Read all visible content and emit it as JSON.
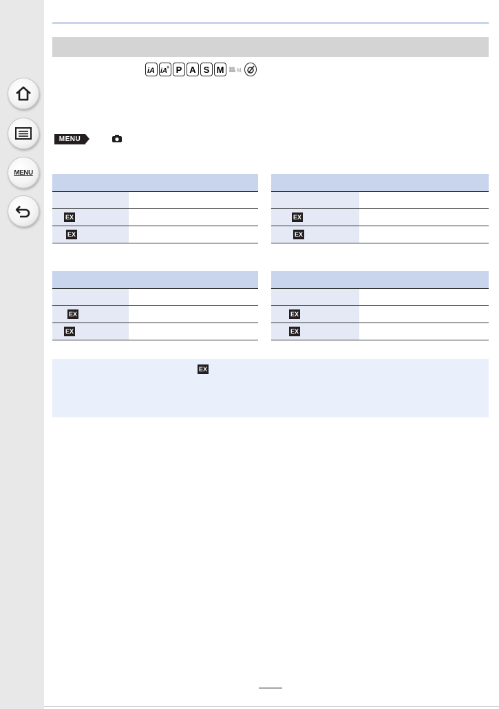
{
  "sidebar": {
    "buttons": [
      {
        "name": "home",
        "icon": "home-icon"
      },
      {
        "name": "contents",
        "icon": "list-icon"
      },
      {
        "name": "menu",
        "icon": "menu-icon",
        "label": "MENU"
      },
      {
        "name": "back",
        "icon": "back-arrow-icon"
      }
    ]
  },
  "header": {
    "title": ""
  },
  "mode_icons": [
    "iA",
    "iA+",
    "P",
    "A",
    "S",
    "M",
    "M",
    "creative"
  ],
  "menu_path": {
    "badge": "MENU",
    "icon": "camera-icon"
  },
  "badge_text": "EX",
  "tables": [
    {
      "header": [
        "",
        ""
      ],
      "rows": [
        [
          "",
          ""
        ],
        [
          "EX",
          ""
        ],
        [
          "EX",
          ""
        ]
      ]
    },
    {
      "header": [
        "",
        ""
      ],
      "rows": [
        [
          "",
          ""
        ],
        [
          "EX",
          ""
        ],
        [
          "EX",
          ""
        ]
      ]
    },
    {
      "header": [
        "",
        ""
      ],
      "rows": [
        [
          "",
          ""
        ],
        [
          "EX",
          ""
        ],
        [
          "EX",
          ""
        ]
      ]
    },
    {
      "header": [
        "",
        ""
      ],
      "rows": [
        [
          "",
          ""
        ],
        [
          "EX",
          ""
        ],
        [
          "EX",
          ""
        ]
      ]
    }
  ],
  "note": {
    "badge": "EX"
  },
  "page_number": "",
  "colors": {
    "sidebar": "#e8e8e8",
    "table_header": "#c9d5ec",
    "table_first_col": "#e4e9f5",
    "note_bg": "#eaf0fb",
    "header_bar": "#d4d4d4"
  }
}
